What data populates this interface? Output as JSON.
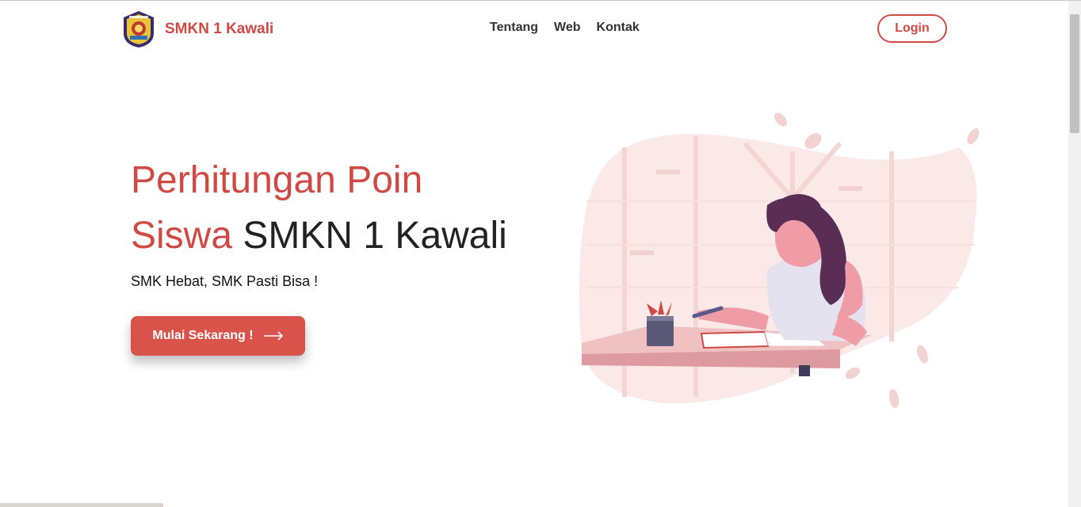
{
  "brand": {
    "name": "SMKN 1 Kawali"
  },
  "nav": {
    "items": [
      "Tentang",
      "Web",
      "Kontak"
    ],
    "login_label": "Login"
  },
  "hero": {
    "title_accent_1": "Perhitungan Poin",
    "title_accent_2": "Siswa",
    "title_rest": " SMKN 1 Kawali",
    "subtitle": "SMK Hebat, SMK Pasti Bisa !",
    "cta_label": "Mulai Sekarang !"
  },
  "colors": {
    "accent": "#d04a43",
    "button": "#d9534a",
    "text": "#222222"
  },
  "icons": {
    "logo": "school-crest-logo",
    "cta": "arrow-right-icon",
    "illustration": "woman-writing-illustration"
  }
}
